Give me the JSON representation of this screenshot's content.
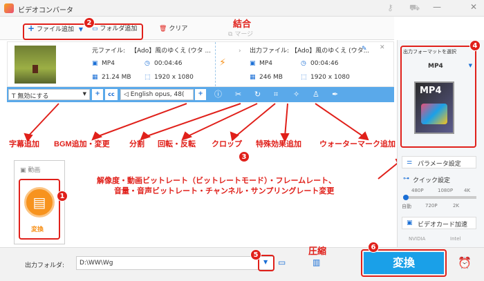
{
  "app": {
    "title": "ビデオコンバータ"
  },
  "toolbar": {
    "add_file": "ファイル追加",
    "add_folder": "フォルダ追加",
    "clear": "クリア",
    "merge": "マージ"
  },
  "file": {
    "src_label": "元ファイル:",
    "src_name": "【Ado】風のゆくえ (ウタ ...",
    "src_format": "MP4",
    "src_duration": "00:04:46",
    "src_size": "21.24 MB",
    "src_resolution": "1920 x 1080",
    "out_label": "出力ファイル:",
    "out_name": "【Ado】風のゆくえ (ウタ...",
    "out_format": "MP4",
    "out_duration": "00:04:46",
    "out_size": "246 MB",
    "out_resolution": "1920 x 1080"
  },
  "edit": {
    "subtitle_select": "無効にする",
    "audio_select": "English opus, 48(",
    "cc": "cc"
  },
  "right": {
    "format_header": "出力フォーマットを選択",
    "format_value": "MP4",
    "format_tile": "MP4",
    "param_button": "パラメータ設定",
    "quick_label": "クイック設定",
    "quick_top": [
      "480P",
      "1080P",
      "4K"
    ],
    "quick_bottom": [
      "自動",
      "720P",
      "2K"
    ],
    "gpu_label": "ビデオカード加速",
    "gpu_brands": [
      "NVIDIA",
      "Intel"
    ]
  },
  "left_tool": {
    "header": "動画",
    "convert": "変換"
  },
  "bottom": {
    "folder_label": "出力フォルダ:",
    "folder_path": "D:\\WW\\Wg",
    "convert_button": "変換"
  },
  "annotations": {
    "merge": "結合",
    "compress": "圧縮",
    "subtitle": "字幕追加",
    "bgm": "BGM追加・変更",
    "split": "分割",
    "rotate": "回転・反転",
    "crop": "クロップ",
    "effects": "特殊効果追加",
    "watermark": "ウォーターマーク追加",
    "params_line1": "解像度・動画ビットレート（ビットレートモード）・フレームレート、",
    "params_line2": "音量・音声ビットレート・チャンネル・サンプリングレート変更",
    "badges": [
      "1",
      "2",
      "3",
      "4",
      "5",
      "6"
    ]
  },
  "colors": {
    "accent": "#1aa0e8",
    "annotation": "#e0201a",
    "edit_bar": "#5aa9ea"
  }
}
